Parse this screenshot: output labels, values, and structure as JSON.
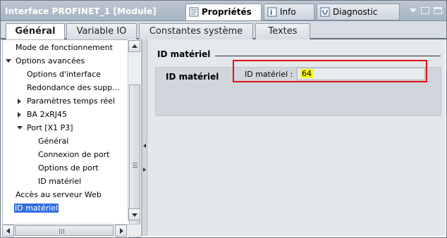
{
  "window": {
    "title": "Interface PROFINET_1 [Module]"
  },
  "panel_tabs": [
    {
      "label": "Propriétés",
      "icon": "properties-icon"
    },
    {
      "label": "Info",
      "icon": "info-icon"
    },
    {
      "label": "Diagnostic",
      "icon": "diagnostic-icon"
    }
  ],
  "section_tabs": [
    {
      "label": "Général"
    },
    {
      "label": "Variable IO"
    },
    {
      "label": "Constantes système"
    },
    {
      "label": "Textes"
    }
  ],
  "tree": {
    "items": [
      {
        "label": "Mode de fonctionnement"
      },
      {
        "label": "Options avancées",
        "expander": "expanded"
      },
      {
        "label": "Options d'interface"
      },
      {
        "label": "Redondance des supp..."
      },
      {
        "label": "Paramètres temps réel",
        "expander": "collapsed"
      },
      {
        "label": "BA 2xRJ45",
        "expander": "collapsed"
      },
      {
        "label": "Port [X1 P3]",
        "expander": "expanded"
      },
      {
        "label": "Général"
      },
      {
        "label": "Connexion de port"
      },
      {
        "label": "Options de port"
      },
      {
        "label": "ID matériel"
      },
      {
        "label": "Accès au serveur Web"
      },
      {
        "label": "ID matériel",
        "selected": true
      }
    ]
  },
  "content": {
    "section_heading": "ID matériel",
    "group_title": "ID matériel",
    "field": {
      "label": "ID matériel :",
      "value": "64"
    }
  },
  "colors": {
    "selection": "#2f6ee0",
    "highlight_border": "#e01010",
    "value_highlight": "#f3f31a"
  }
}
